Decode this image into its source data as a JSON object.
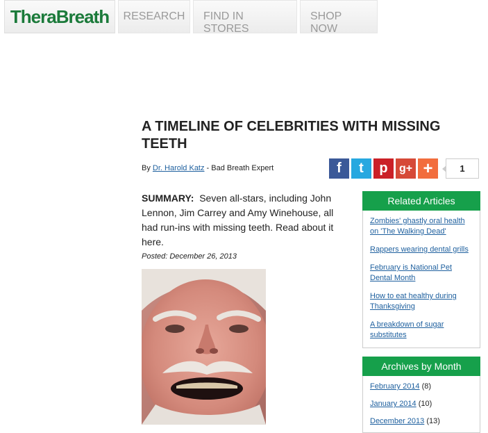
{
  "nav": {
    "logo": "TheraBreath",
    "items": [
      {
        "label": "RESEARCH"
      },
      {
        "label": "FIND IN STORES"
      },
      {
        "label": "SHOP NOW"
      }
    ]
  },
  "article": {
    "title": "A TIMELINE OF CELEBRITIES WITH MISSING TEETH",
    "by_prefix": "By ",
    "author": "Dr. Harold Katz",
    "author_suffix": " - Bad Breath Expert",
    "summary_label": "SUMMARY:",
    "summary_text": "Seven all-stars, including John Lennon, Jim Carrey and Amy Winehouse, all had run-ins with missing teeth. Read about it here.",
    "posted": "Posted: December 26, 2013"
  },
  "share": {
    "buttons": [
      {
        "name": "facebook-icon",
        "glyph": "f",
        "color": "#3b5998"
      },
      {
        "name": "twitter-icon",
        "glyph": "t",
        "color": "#27a8e0"
      },
      {
        "name": "pinterest-icon",
        "glyph": "p",
        "color": "#cb2027"
      },
      {
        "name": "google-plus-icon",
        "glyph": "g+",
        "color": "#d64937"
      },
      {
        "name": "addthis-icon",
        "glyph": "+",
        "color": "#f26d3d"
      }
    ],
    "count": "1"
  },
  "sidebar": {
    "related": {
      "heading": "Related Articles",
      "items": [
        {
          "label": "Zombies' ghastly oral health on 'The Walking Dead'"
        },
        {
          "label": "Rappers wearing dental grills"
        },
        {
          "label": "February is National Pet Dental Month"
        },
        {
          "label": "How to eat healthy during Thanksgiving"
        },
        {
          "label": "A breakdown of sugar substitutes"
        }
      ]
    },
    "archives": {
      "heading": "Archives by Month",
      "items": [
        {
          "label": "February 2014",
          "count": "(8)"
        },
        {
          "label": "January 2014",
          "count": "(10)"
        },
        {
          "label": "December 2013",
          "count": "(13)"
        }
      ]
    }
  },
  "colors": {
    "brand_green": "#16a04b",
    "logo_green": "#1b7a3a",
    "link_blue": "#1d5f9e"
  }
}
